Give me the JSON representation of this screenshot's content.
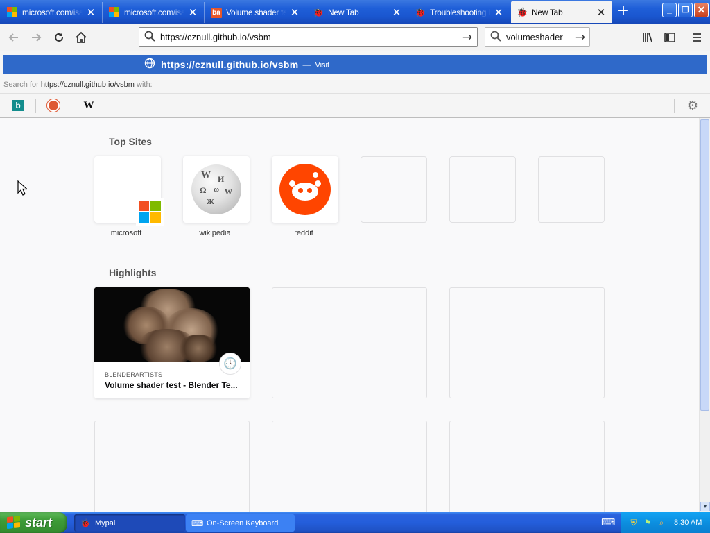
{
  "tabs": [
    {
      "title": "microsoft.com/isap",
      "favicon": "microsoft-logo",
      "active": false
    },
    {
      "title": "microsoft.com/isap",
      "favicon": "microsoft-logo",
      "active": false
    },
    {
      "title": "Volume shader tes",
      "favicon": "blenderartists-logo",
      "favicon_text": "ba",
      "active": false
    },
    {
      "title": "New Tab",
      "favicon": "mypal-logo",
      "active": false
    },
    {
      "title": "Troubleshooting In",
      "favicon": "mypal-logo",
      "active": false
    },
    {
      "title": "New Tab",
      "favicon": "mypal-logo",
      "active": true
    }
  ],
  "navbar": {
    "url_value": "https://cznull.github.io/vsbm",
    "search_value": "volumeshader"
  },
  "autocomplete": {
    "heuristic_url": "https://cznull.github.io/vsbm",
    "heuristic_dash": "—",
    "heuristic_action": "Visit",
    "search_for_prefix": "Search for",
    "search_for_url": "https://cznull.github.io/vsbm",
    "search_for_suffix": "with:",
    "engines": [
      "bing",
      "duckduckgo",
      "wikipedia"
    ],
    "wiki_letter": "W"
  },
  "newtab": {
    "topsites_title": "Top Sites",
    "topsites": [
      {
        "label": "microsoft",
        "icon": "microsoft-logo"
      },
      {
        "label": "wikipedia",
        "icon": "wikipedia-globe"
      },
      {
        "label": "reddit",
        "icon": "reddit-logo"
      },
      {
        "label": "",
        "icon": ""
      },
      {
        "label": "",
        "icon": ""
      },
      {
        "label": "",
        "icon": ""
      }
    ],
    "highlights_title": "Highlights",
    "highlights": [
      {
        "source": "BLENDERARTISTS",
        "title": "Volume shader test - Blender Te..."
      }
    ]
  },
  "taskbar": {
    "start_label": "start",
    "tasks": [
      {
        "label": "Mypal",
        "active": true
      },
      {
        "label": "On-Screen Keyboard",
        "active": false
      }
    ],
    "clock": "8:30 AM"
  },
  "colors": {
    "titlebar_blue": "#1f5fd8",
    "selection_blue": "#2f69c9",
    "start_green": "#3d9b37",
    "reddit_orange": "#ff4500",
    "bing_teal": "#138d8d"
  }
}
